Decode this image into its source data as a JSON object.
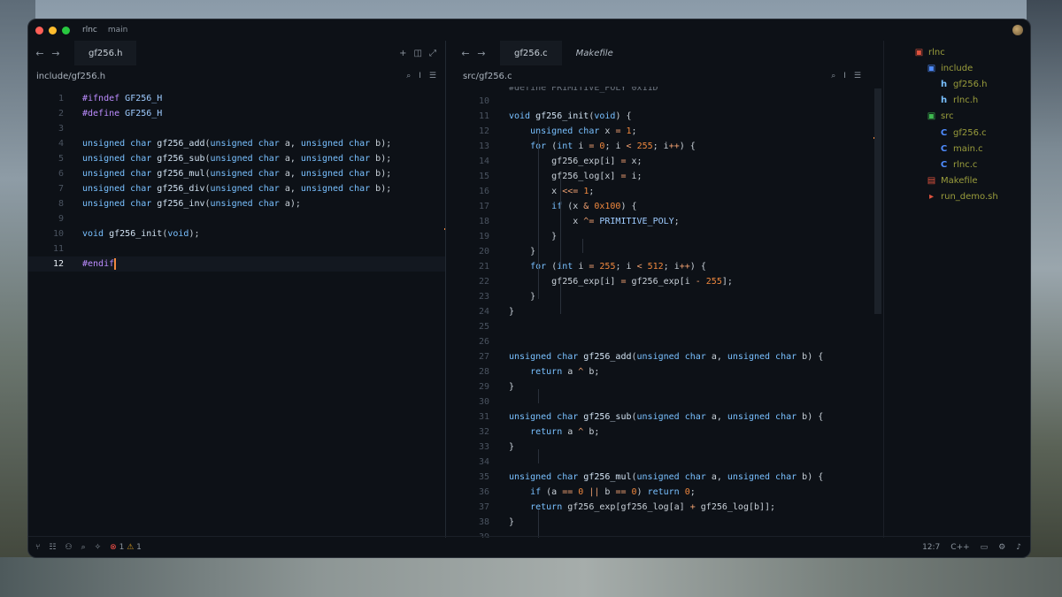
{
  "window": {
    "project": "rlnc",
    "branch": "main"
  },
  "left_pane": {
    "tab": "gf256.h",
    "path": "include/gf256.h",
    "lines": [
      {
        "n": "1",
        "code": [
          [
            "pp",
            "#ifndef "
          ],
          [
            "id",
            "GF256_H"
          ]
        ]
      },
      {
        "n": "2",
        "code": [
          [
            "pp",
            "#define "
          ],
          [
            "id",
            "GF256_H"
          ]
        ]
      },
      {
        "n": "3",
        "code": []
      },
      {
        "n": "4",
        "code": [
          [
            "kw",
            "unsigned char "
          ],
          [
            "fn",
            "gf256_add"
          ],
          [
            "",
            "("
          ],
          [
            "kw",
            "unsigned char "
          ],
          [
            "",
            "a, "
          ],
          [
            "kw",
            "unsigned char "
          ],
          [
            "",
            "b);"
          ]
        ]
      },
      {
        "n": "5",
        "code": [
          [
            "kw",
            "unsigned char "
          ],
          [
            "fn",
            "gf256_sub"
          ],
          [
            "",
            "("
          ],
          [
            "kw",
            "unsigned char "
          ],
          [
            "",
            "a, "
          ],
          [
            "kw",
            "unsigned char "
          ],
          [
            "",
            "b);"
          ]
        ]
      },
      {
        "n": "6",
        "code": [
          [
            "kw",
            "unsigned char "
          ],
          [
            "fn",
            "gf256_mul"
          ],
          [
            "",
            "("
          ],
          [
            "kw",
            "unsigned char "
          ],
          [
            "",
            "a, "
          ],
          [
            "kw",
            "unsigned char "
          ],
          [
            "",
            "b);"
          ]
        ]
      },
      {
        "n": "7",
        "code": [
          [
            "kw",
            "unsigned char "
          ],
          [
            "fn",
            "gf256_div"
          ],
          [
            "",
            "("
          ],
          [
            "kw",
            "unsigned char "
          ],
          [
            "",
            "a, "
          ],
          [
            "kw",
            "unsigned char "
          ],
          [
            "",
            "b);"
          ]
        ]
      },
      {
        "n": "8",
        "code": [
          [
            "kw",
            "unsigned char "
          ],
          [
            "fn",
            "gf256_inv"
          ],
          [
            "",
            "("
          ],
          [
            "kw",
            "unsigned char "
          ],
          [
            "",
            "a);"
          ]
        ]
      },
      {
        "n": "9",
        "code": []
      },
      {
        "n": "10",
        "code": [
          [
            "kw",
            "void "
          ],
          [
            "fn",
            "gf256_init"
          ],
          [
            "",
            "("
          ],
          [
            "kw",
            "void"
          ],
          [
            "",
            ");"
          ]
        ]
      },
      {
        "n": "11",
        "code": []
      },
      {
        "n": "12",
        "code": [
          [
            "pp",
            "#endif"
          ]
        ],
        "current": true
      }
    ]
  },
  "right_pane": {
    "tabs": [
      "gf256.c",
      "Makefile"
    ],
    "path": "src/gf256.c",
    "lines": [
      {
        "n": "10",
        "code": []
      },
      {
        "n": "11",
        "code": [
          [
            "kw",
            "void "
          ],
          [
            "fn",
            "gf256_init"
          ],
          [
            "",
            "("
          ],
          [
            "kw",
            "void"
          ],
          [
            "",
            ") {"
          ]
        ]
      },
      {
        "n": "12",
        "code": [
          [
            "",
            "    "
          ],
          [
            "kw",
            "unsigned char "
          ],
          [
            "",
            "x "
          ],
          [
            "op",
            "= "
          ],
          [
            "num",
            "1"
          ],
          [
            "",
            ";"
          ]
        ]
      },
      {
        "n": "13",
        "code": [
          [
            "",
            "    "
          ],
          [
            "kw",
            "for "
          ],
          [
            "",
            "("
          ],
          [
            "kw",
            "int "
          ],
          [
            "",
            "i "
          ],
          [
            "op",
            "= "
          ],
          [
            "num",
            "0"
          ],
          [
            "",
            "; i "
          ],
          [
            "op",
            "< "
          ],
          [
            "num",
            "255"
          ],
          [
            "",
            "; i"
          ],
          [
            "op",
            "++"
          ],
          [
            "",
            ") {"
          ]
        ]
      },
      {
        "n": "14",
        "code": [
          [
            "",
            "        gf256_exp[i] "
          ],
          [
            "op",
            "= "
          ],
          [
            "",
            "x;"
          ]
        ]
      },
      {
        "n": "15",
        "code": [
          [
            "",
            "        gf256_log[x] "
          ],
          [
            "op",
            "= "
          ],
          [
            "",
            "i;"
          ]
        ]
      },
      {
        "n": "16",
        "code": [
          [
            "",
            "        x "
          ],
          [
            "op",
            "<<= "
          ],
          [
            "num",
            "1"
          ],
          [
            "",
            ";"
          ]
        ]
      },
      {
        "n": "17",
        "code": [
          [
            "",
            "        "
          ],
          [
            "kw",
            "if "
          ],
          [
            "",
            "(x "
          ],
          [
            "op",
            "& "
          ],
          [
            "num",
            "0x100"
          ],
          [
            "",
            ") {"
          ]
        ]
      },
      {
        "n": "18",
        "code": [
          [
            "",
            "            x "
          ],
          [
            "op",
            "^= "
          ],
          [
            "id",
            "PRIMITIVE_POLY"
          ],
          [
            "",
            ";"
          ]
        ]
      },
      {
        "n": "19",
        "code": [
          [
            "",
            "        }"
          ]
        ]
      },
      {
        "n": "20",
        "code": [
          [
            "",
            "    }"
          ]
        ]
      },
      {
        "n": "21",
        "code": [
          [
            "",
            "    "
          ],
          [
            "kw",
            "for "
          ],
          [
            "",
            "("
          ],
          [
            "kw",
            "int "
          ],
          [
            "",
            "i "
          ],
          [
            "op",
            "= "
          ],
          [
            "num",
            "255"
          ],
          [
            "",
            "; i "
          ],
          [
            "op",
            "< "
          ],
          [
            "num",
            "512"
          ],
          [
            "",
            "; i"
          ],
          [
            "op",
            "++"
          ],
          [
            "",
            ") {"
          ]
        ]
      },
      {
        "n": "22",
        "code": [
          [
            "",
            "        gf256_exp[i] "
          ],
          [
            "op",
            "= "
          ],
          [
            "",
            "gf256_exp[i "
          ],
          [
            "op",
            "- "
          ],
          [
            "num",
            "255"
          ],
          [
            "",
            "];"
          ]
        ]
      },
      {
        "n": "23",
        "code": [
          [
            "",
            "    }"
          ]
        ]
      },
      {
        "n": "24",
        "code": [
          [
            "",
            "}"
          ]
        ]
      },
      {
        "n": "25",
        "code": []
      },
      {
        "n": "26",
        "code": []
      },
      {
        "n": "27",
        "code": [
          [
            "kw",
            "unsigned char "
          ],
          [
            "fn",
            "gf256_add"
          ],
          [
            "",
            "("
          ],
          [
            "kw",
            "unsigned char "
          ],
          [
            "",
            "a, "
          ],
          [
            "kw",
            "unsigned char "
          ],
          [
            "",
            "b) {"
          ]
        ]
      },
      {
        "n": "28",
        "code": [
          [
            "",
            "    "
          ],
          [
            "kw",
            "return "
          ],
          [
            "",
            "a "
          ],
          [
            "op",
            "^ "
          ],
          [
            "",
            "b;"
          ]
        ]
      },
      {
        "n": "29",
        "code": [
          [
            "",
            "}"
          ]
        ]
      },
      {
        "n": "30",
        "code": []
      },
      {
        "n": "31",
        "code": [
          [
            "kw",
            "unsigned char "
          ],
          [
            "fn",
            "gf256_sub"
          ],
          [
            "",
            "("
          ],
          [
            "kw",
            "unsigned char "
          ],
          [
            "",
            "a, "
          ],
          [
            "kw",
            "unsigned char "
          ],
          [
            "",
            "b) {"
          ]
        ]
      },
      {
        "n": "32",
        "code": [
          [
            "",
            "    "
          ],
          [
            "kw",
            "return "
          ],
          [
            "",
            "a "
          ],
          [
            "op",
            "^ "
          ],
          [
            "",
            "b;"
          ]
        ]
      },
      {
        "n": "33",
        "code": [
          [
            "",
            "}"
          ]
        ]
      },
      {
        "n": "34",
        "code": []
      },
      {
        "n": "35",
        "code": [
          [
            "kw",
            "unsigned char "
          ],
          [
            "fn",
            "gf256_mul"
          ],
          [
            "",
            "("
          ],
          [
            "kw",
            "unsigned char "
          ],
          [
            "",
            "a, "
          ],
          [
            "kw",
            "unsigned char "
          ],
          [
            "",
            "b) {"
          ]
        ]
      },
      {
        "n": "36",
        "code": [
          [
            "",
            "    "
          ],
          [
            "kw",
            "if "
          ],
          [
            "",
            "(a "
          ],
          [
            "op",
            "== "
          ],
          [
            "num",
            "0 "
          ],
          [
            "op",
            "|| "
          ],
          [
            "",
            "b "
          ],
          [
            "op",
            "== "
          ],
          [
            "num",
            "0"
          ],
          [
            "",
            ") "
          ],
          [
            "kw",
            "return "
          ],
          [
            "num",
            "0"
          ],
          [
            "",
            ";"
          ]
        ]
      },
      {
        "n": "37",
        "code": [
          [
            "",
            "    "
          ],
          [
            "kw",
            "return "
          ],
          [
            "",
            "gf256_exp[gf256_log[a] "
          ],
          [
            "op",
            "+ "
          ],
          [
            "",
            "gf256_log[b]];"
          ]
        ]
      },
      {
        "n": "38",
        "code": [
          [
            "",
            "}"
          ]
        ]
      },
      {
        "n": "39",
        "code": []
      }
    ]
  },
  "tree": [
    {
      "label": "rlnc",
      "icon": "folder-icon",
      "indent": 0,
      "glyph": "▣",
      "color": "#e0533e"
    },
    {
      "label": "include",
      "icon": "folder-icon",
      "indent": 1,
      "glyph": "▣",
      "color": "#4f8cff"
    },
    {
      "label": "gf256.h",
      "icon": "header-file-icon",
      "indent": 2,
      "glyph": "h",
      "color": "#79c0ff"
    },
    {
      "label": "rlnc.h",
      "icon": "header-file-icon",
      "indent": 2,
      "glyph": "h",
      "color": "#79c0ff"
    },
    {
      "label": "src",
      "icon": "folder-icon",
      "indent": 1,
      "glyph": "▣",
      "color": "#3fb950"
    },
    {
      "label": "gf256.c",
      "icon": "c-file-icon",
      "indent": 2,
      "glyph": "C",
      "color": "#4f8cff"
    },
    {
      "label": "main.c",
      "icon": "c-file-icon",
      "indent": 2,
      "glyph": "C",
      "color": "#4f8cff"
    },
    {
      "label": "rlnc.c",
      "icon": "c-file-icon",
      "indent": 2,
      "glyph": "C",
      "color": "#4f8cff"
    },
    {
      "label": "Makefile",
      "icon": "makefile-icon",
      "indent": 1,
      "glyph": "▤",
      "color": "#e0533e"
    },
    {
      "label": "run_demo.sh",
      "icon": "shell-script-icon",
      "indent": 1,
      "glyph": "▸",
      "color": "#e0533e"
    }
  ],
  "tree_label_color": "#9a9d3c",
  "status": {
    "errors": "1",
    "warnings": "1",
    "cursor_position": "12:7",
    "language": "C++"
  }
}
